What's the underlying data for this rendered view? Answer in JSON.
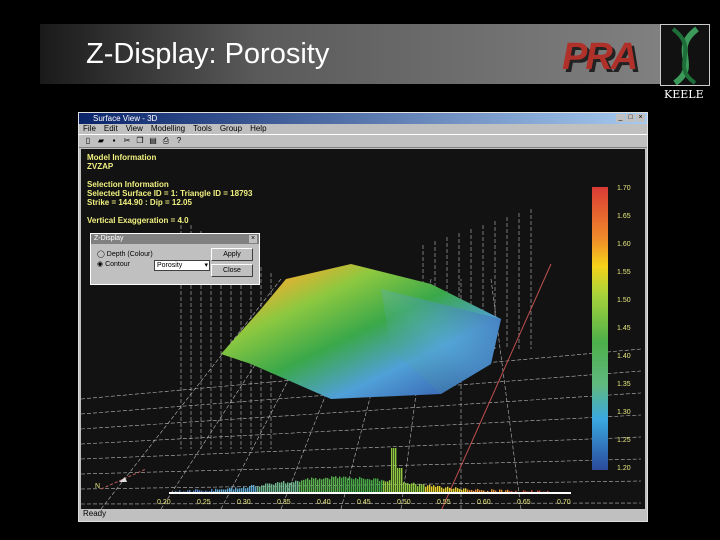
{
  "slide": {
    "title": "Z-Display: Porosity",
    "logo": "PRA",
    "institution": "KEELE"
  },
  "window": {
    "title": "Surface View - 3D",
    "menu": [
      "File",
      "Edit",
      "View",
      "Modelling",
      "Tools",
      "Group",
      "Help"
    ],
    "status": "Ready"
  },
  "info": {
    "line1": "Model Information",
    "line2": "ZVZAP",
    "line3": "Selection Information",
    "line4": "Selected Surface ID = 1: Triangle ID = 18793",
    "line5": "Strike = 144.90 : Dip = 12.05",
    "line6": "Vertical Exaggeration = 4.0"
  },
  "dialog": {
    "title": "Z-Display",
    "radio1": "Depth (Colour)",
    "radio2": "Contour",
    "select": "Porosity",
    "apply": "Apply",
    "close": "Close"
  },
  "colorbar": {
    "labels": [
      "1.70",
      "1.65",
      "1.60",
      "1.55",
      "1.50",
      "1.45",
      "1.40",
      "1.35",
      "1.30",
      "1.25",
      "1.20"
    ]
  },
  "histogram": {
    "labels": [
      "0.20",
      "0.25",
      "0.30",
      "0.35",
      "0.40",
      "0.45",
      "0.50",
      "0.55",
      "0.60",
      "0.65",
      "0.70"
    ]
  },
  "compass": {
    "label": "N"
  }
}
